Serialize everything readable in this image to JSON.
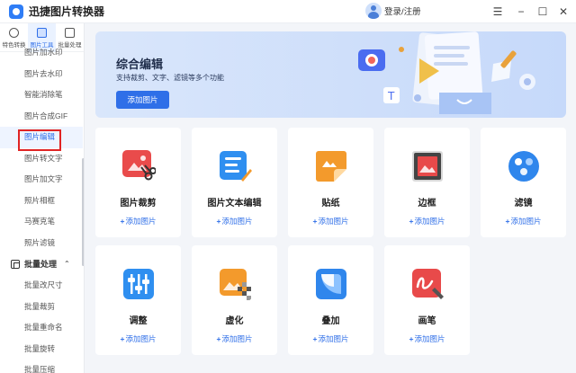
{
  "app": {
    "title": "迅捷图片转换器"
  },
  "header": {
    "login_label": "登录/注册"
  },
  "window_controls": {
    "menu": "☰",
    "minimize": "−",
    "maximize": "☐",
    "close": "✕"
  },
  "sidebar": {
    "tabs": [
      {
        "label": "特色转换",
        "icon": "convert-icon",
        "active": false
      },
      {
        "label": "图片工具",
        "icon": "image-tool-icon",
        "active": true
      },
      {
        "label": "批量处理",
        "icon": "batch-icon",
        "active": false
      }
    ],
    "items": [
      {
        "label": "图片加水印"
      },
      {
        "label": "图片去水印"
      },
      {
        "label": "智能消除笔"
      },
      {
        "label": "图片合成GIF"
      },
      {
        "label": "图片编辑"
      },
      {
        "label": "图片转文字"
      },
      {
        "label": "图片加文字"
      },
      {
        "label": "照片相框"
      },
      {
        "label": "马赛克笔"
      },
      {
        "label": "照片滤镜"
      }
    ],
    "section": {
      "label": "批量处理",
      "icon": "batch-section-icon",
      "chevron": "⌃"
    },
    "batch_items": [
      {
        "label": "批量改尺寸"
      },
      {
        "label": "批量裁剪"
      },
      {
        "label": "批量重命名"
      },
      {
        "label": "批量旋转"
      },
      {
        "label": "批量压缩"
      }
    ]
  },
  "banner": {
    "title": "综合编辑",
    "subtitle": "支持裁剪、文字、滤镜等多个功能",
    "button_label": "添加图片"
  },
  "cards": [
    {
      "title": "图片裁剪",
      "add_label": "添加图片",
      "icon": "crop-icon",
      "color": "#e94b4b"
    },
    {
      "title": "图片文本编辑",
      "add_label": "添加图片",
      "icon": "text-edit-icon",
      "color": "#2f8ff0"
    },
    {
      "title": "贴纸",
      "add_label": "添加图片",
      "icon": "sticker-icon",
      "color": "#f39a2c"
    },
    {
      "title": "边框",
      "add_label": "添加图片",
      "icon": "frame-icon",
      "color": "#e84a4a"
    },
    {
      "title": "滤镜",
      "add_label": "添加图片",
      "icon": "filter-icon",
      "color": "#2f86ec"
    },
    {
      "title": "调整",
      "add_label": "添加图片",
      "icon": "adjust-icon",
      "color": "#2f8ff0"
    },
    {
      "title": "虚化",
      "add_label": "添加图片",
      "icon": "blur-icon",
      "color": "#f39a2c"
    },
    {
      "title": "叠加",
      "add_label": "添加图片",
      "icon": "overlay-icon",
      "color": "#2f86ec"
    },
    {
      "title": "画笔",
      "add_label": "添加图片",
      "icon": "brush-icon",
      "color": "#e84a4a"
    }
  ],
  "colors": {
    "accent": "#2f6fe8",
    "banner_bg": "#c6d9fa",
    "highlight_box": "#e02424"
  }
}
